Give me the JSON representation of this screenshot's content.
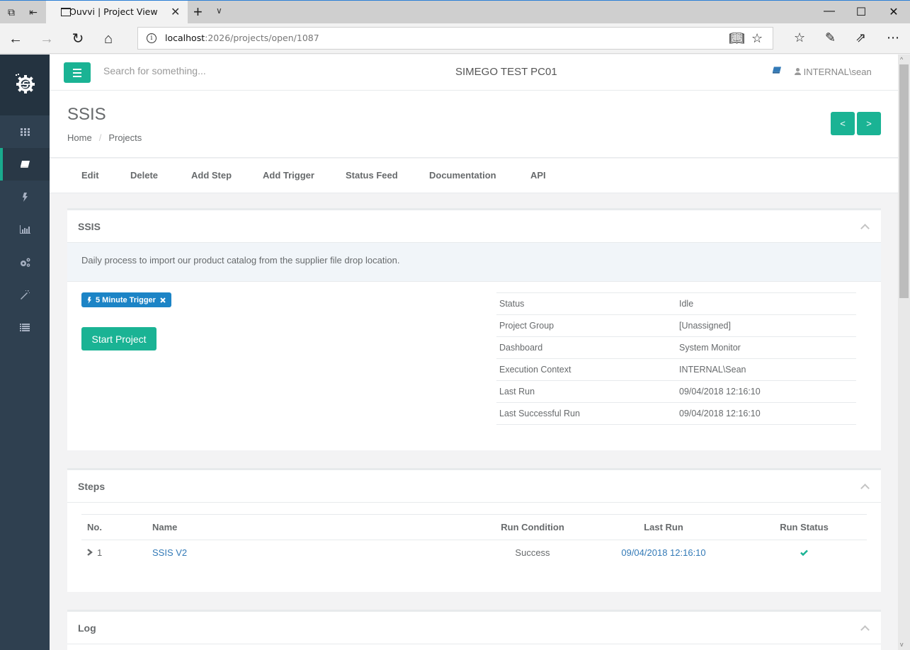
{
  "browser": {
    "tab_title": "Ouvvi | Project View",
    "url_host": "localhost",
    "url_path": ":2026/projects/open/1087"
  },
  "topnav": {
    "search_placeholder": "Search for something...",
    "machine_name": "SIMEGO TEST PC01",
    "user": "INTERNAL\\sean"
  },
  "sidebar": {
    "items": [
      {
        "icon": "grid-icon"
      },
      {
        "icon": "book-icon",
        "active": true
      },
      {
        "icon": "bolt-icon"
      },
      {
        "icon": "bar-chart-icon"
      },
      {
        "icon": "gears-icon"
      },
      {
        "icon": "magic-wand-icon"
      },
      {
        "icon": "list-icon"
      }
    ]
  },
  "heading": {
    "title": "SSIS",
    "breadcrumb": [
      "Home",
      "Projects"
    ],
    "prev_label": "<",
    "next_label": ">"
  },
  "actions": [
    "Edit",
    "Delete",
    "Add Step",
    "Add Trigger",
    "Status Feed",
    "Documentation",
    "API"
  ],
  "project_panel": {
    "title": "SSIS",
    "description": "Daily process to import our product catalog from the supplier file drop location.",
    "trigger": "5 Minute Trigger",
    "start_label": "Start Project",
    "info": [
      {
        "label": "Status",
        "value": "Idle",
        "link": false
      },
      {
        "label": "Project Group",
        "value": "[Unassigned]",
        "link": false
      },
      {
        "label": "Dashboard",
        "value": "System Monitor",
        "link": true
      },
      {
        "label": "Execution Context",
        "value": "INTERNAL\\Sean",
        "link": true
      },
      {
        "label": "Last Run",
        "value": "09/04/2018 12:16:10",
        "link": false
      },
      {
        "label": "Last Successful Run",
        "value": "09/04/2018 12:16:10",
        "link": false
      }
    ]
  },
  "steps_panel": {
    "title": "Steps",
    "columns": [
      "No.",
      "Name",
      "Run Condition",
      "Last Run",
      "Run Status"
    ],
    "rows": [
      {
        "no": "1",
        "name": "SSIS V2",
        "run_condition": "Success",
        "last_run": "09/04/2018 12:16:10",
        "run_status": "success"
      }
    ]
  },
  "log_panel": {
    "title": "Log"
  },
  "colors": {
    "primary": "#1ab394",
    "info": "#1c84c6",
    "link": "#337ab7",
    "sidebar": "#2f4050"
  }
}
